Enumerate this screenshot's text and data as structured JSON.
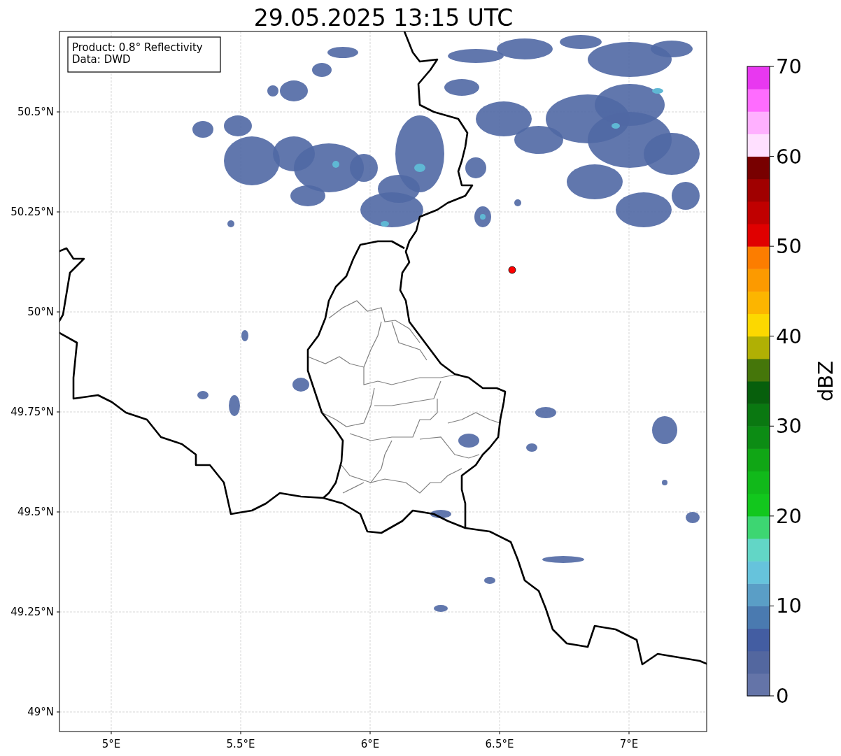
{
  "title": "29.05.2025 13:15 UTC",
  "info_box": [
    "Product: 0.8° Reflectivity",
    "Data: DWD"
  ],
  "map": {
    "lat_labels": [
      "50.5°N",
      "50.25°N",
      "50°N",
      "49.75°N",
      "49.5°N",
      "49.25°N",
      "49°N"
    ],
    "lon_labels": [
      "5°E",
      "5.5°E",
      "6°E",
      "6.5°E",
      "7°E"
    ]
  },
  "colorbar": {
    "label": "dBZ",
    "ticks": [
      "70",
      "60",
      "50",
      "40",
      "30",
      "20",
      "10",
      "0"
    ],
    "bins": [
      {
        "color": "#6474a8"
      },
      {
        "color": "#53679f"
      },
      {
        "color": "#435da2"
      },
      {
        "color": "#4a7ab0"
      },
      {
        "color": "#5a9ec6"
      },
      {
        "color": "#66c3dc"
      },
      {
        "color": "#62d6c6"
      },
      {
        "color": "#3dd672"
      },
      {
        "color": "#12c71d"
      },
      {
        "color": "#11b91a"
      },
      {
        "color": "#10a615"
      },
      {
        "color": "#0c8c14"
      },
      {
        "color": "#0a7811"
      },
      {
        "color": "#075f0c"
      },
      {
        "color": "#45760a"
      },
      {
        "color": "#b0b004"
      },
      {
        "color": "#fcd800"
      },
      {
        "color": "#fcb500"
      },
      {
        "color": "#fc9a00"
      },
      {
        "color": "#fc7d00"
      },
      {
        "color": "#e00000"
      },
      {
        "color": "#c00000"
      },
      {
        "color": "#a00000"
      },
      {
        "color": "#780000"
      },
      {
        "color": "#ffe0ff"
      },
      {
        "color": "#ffb0ff"
      },
      {
        "color": "#ff6cff"
      },
      {
        "color": "#e838f0"
      }
    ]
  }
}
